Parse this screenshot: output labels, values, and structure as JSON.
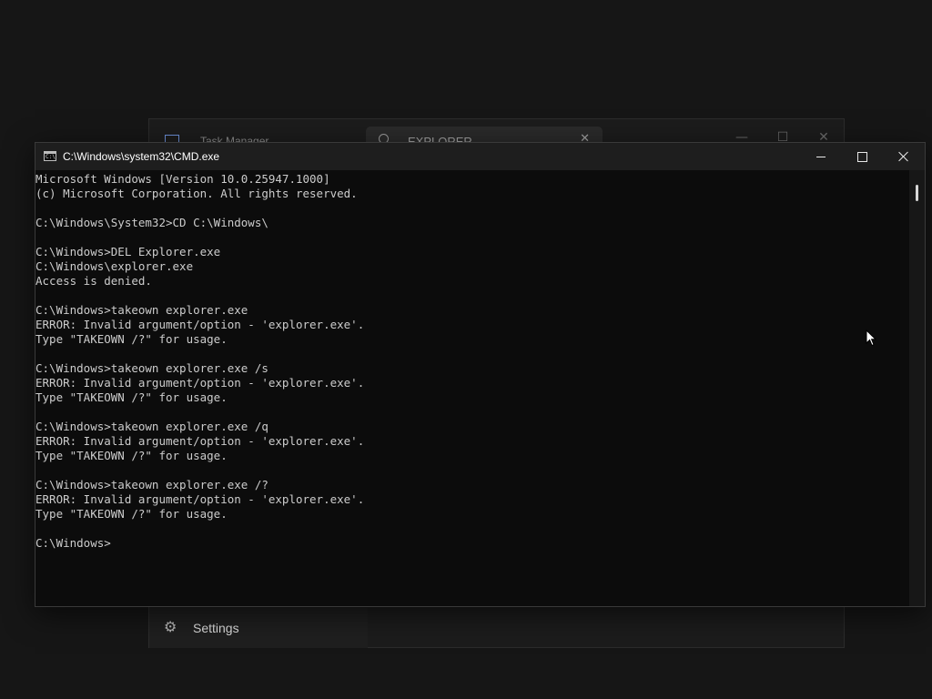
{
  "task_manager": {
    "title": "Task Manager",
    "search_value": "EXPLORER",
    "clear_glyph": "✕",
    "minimize_glyph": "—",
    "maximize_glyph": "☐",
    "close_glyph": "✕",
    "settings_label": "Settings",
    "settings_icon": "gear-icon"
  },
  "cmd": {
    "title": "C:\\Windows\\system32\\CMD.exe",
    "icon_text": "C:\\",
    "lines": [
      "Microsoft Windows [Version 10.0.25947.1000]",
      "(c) Microsoft Corporation. All rights reserved.",
      "",
      "C:\\Windows\\System32>CD C:\\Windows\\",
      "",
      "C:\\Windows>DEL Explorer.exe",
      "C:\\Windows\\explorer.exe",
      "Access is denied.",
      "",
      "C:\\Windows>takeown explorer.exe",
      "ERROR: Invalid argument/option - 'explorer.exe'.",
      "Type \"TAKEOWN /?\" for usage.",
      "",
      "C:\\Windows>takeown explorer.exe /s",
      "ERROR: Invalid argument/option - 'explorer.exe'.",
      "Type \"TAKEOWN /?\" for usage.",
      "",
      "C:\\Windows>takeown explorer.exe /q",
      "ERROR: Invalid argument/option - 'explorer.exe'.",
      "Type \"TAKEOWN /?\" for usage.",
      "",
      "C:\\Windows>takeown explorer.exe /?",
      "ERROR: Invalid argument/option - 'explorer.exe'.",
      "Type \"TAKEOWN /?\" for usage.",
      "",
      "C:\\Windows>"
    ]
  },
  "colors": {
    "console_background": "#0c0c0c",
    "console_text": "#cccccc",
    "titlebar": "#1e1e1e"
  }
}
